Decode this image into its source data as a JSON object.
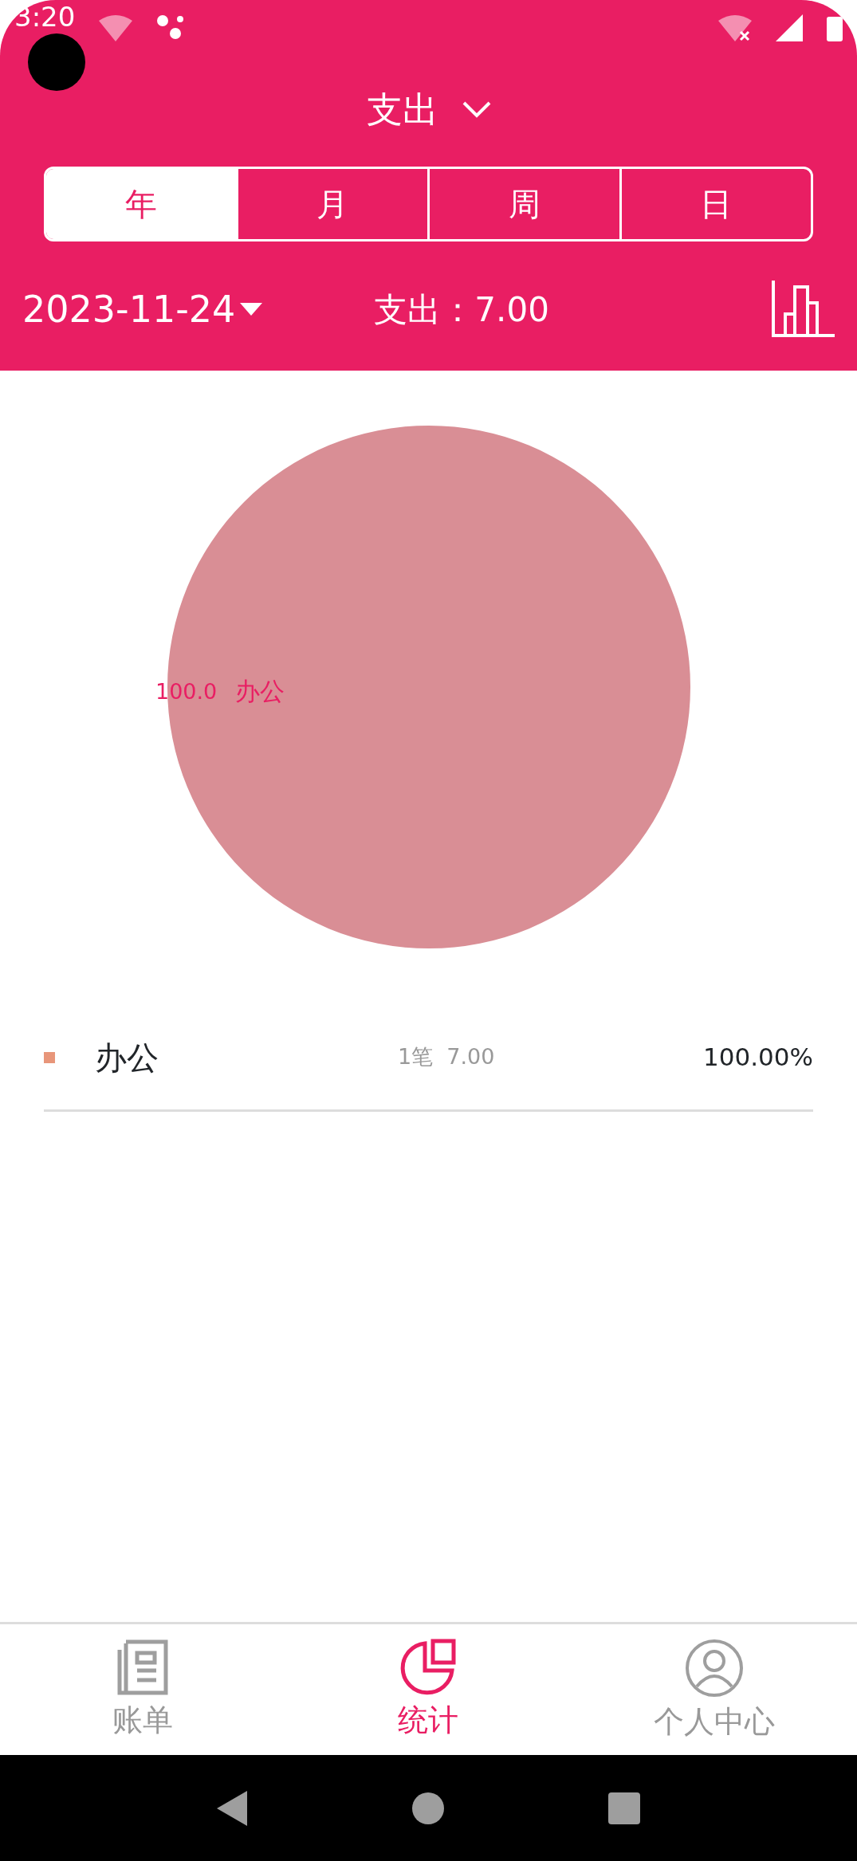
{
  "status_bar": {
    "time": "3:20"
  },
  "header": {
    "title": "支出",
    "tabs": [
      {
        "label": "年",
        "selected": true
      },
      {
        "label": "月",
        "selected": false
      },
      {
        "label": "周",
        "selected": false
      },
      {
        "label": "日",
        "selected": false
      }
    ],
    "date": "2023-11-24",
    "total": "支出：7.00"
  },
  "chart_data": {
    "type": "pie",
    "categories": [
      "办公"
    ],
    "series": [
      {
        "color": "#d98e95",
        "values": [
          100
        ]
      }
    ],
    "value_labels": [
      "100.0"
    ]
  },
  "legend": [
    {
      "name": "办公",
      "color": "#e8967a",
      "count": "1笔",
      "amount": "7.00",
      "percent": "100.00%"
    }
  ],
  "bottom_nav": [
    {
      "label": "账单",
      "kind": "bill",
      "selected": false
    },
    {
      "label": "统计",
      "kind": "stats",
      "selected": true
    },
    {
      "label": "个人中心",
      "kind": "profile",
      "selected": false
    }
  ]
}
